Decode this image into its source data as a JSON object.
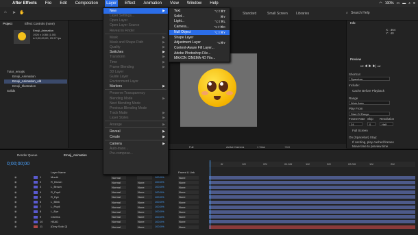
{
  "menubar": {
    "app": "After Effects",
    "items": [
      "File",
      "Edit",
      "Composition",
      "Layer",
      "Effect",
      "Animation",
      "View",
      "Window",
      "Help"
    ],
    "active": "Layer",
    "status": "100%"
  },
  "toolbar": {
    "workspaces": [
      "Standard",
      "Small Screen",
      "Libraries"
    ],
    "search_placeholder": "Search Help"
  },
  "project": {
    "tab_project": "Project",
    "tab_effects": "Effect Controls (none)",
    "comp_name": "Emoji_Animation",
    "info_lines": [
      "1920 x 1080 (1.00)",
      "Δ 0;00;00;00, 29.97 fps"
    ],
    "items": [
      "Tutor_emojis",
      "Emoji_Animation",
      "Emoji_Animation_old",
      "Emoji_Illustration",
      "Solids"
    ]
  },
  "layer_menu": {
    "items": [
      {
        "label": "New",
        "state": "hl",
        "arrow": true
      },
      {
        "label": "Layer Settings...",
        "state": "dis"
      },
      {
        "label": "Open Layer",
        "state": "dis"
      },
      {
        "label": "Open Layer Source",
        "state": "dis"
      },
      {
        "label": "Reveal in Finder",
        "state": "dis"
      },
      {
        "sep": true
      },
      {
        "label": "Mask",
        "state": "dis",
        "arrow": true
      },
      {
        "label": "Mask and Shape Path",
        "state": "dis",
        "arrow": true
      },
      {
        "label": "Quality",
        "state": "dis",
        "arrow": true
      },
      {
        "label": "Switches",
        "state": "",
        "arrow": true
      },
      {
        "label": "Transform",
        "state": "dis",
        "arrow": true
      },
      {
        "label": "Time",
        "state": "dis",
        "arrow": true
      },
      {
        "label": "Frame Blending",
        "state": "dis",
        "arrow": true
      },
      {
        "label": "3D Layer",
        "state": "dis"
      },
      {
        "label": "Guide Layer",
        "state": "dis"
      },
      {
        "label": "Environment Layer",
        "state": "dis"
      },
      {
        "label": "Markers",
        "state": "",
        "arrow": true
      },
      {
        "sep": true
      },
      {
        "label": "Preserve Transparency",
        "state": "dis"
      },
      {
        "label": "Blending Mode",
        "state": "dis",
        "arrow": true
      },
      {
        "label": "Next Blending Mode",
        "state": "dis"
      },
      {
        "label": "Previous Blending Mode",
        "state": "dis"
      },
      {
        "label": "Track Matte",
        "state": "dis",
        "arrow": true
      },
      {
        "label": "Layer Styles",
        "state": "dis",
        "arrow": true
      },
      {
        "sep": true
      },
      {
        "label": "Arrange",
        "state": "dis",
        "arrow": true
      },
      {
        "sep": true
      },
      {
        "label": "Reveal",
        "state": "",
        "arrow": true
      },
      {
        "label": "Create",
        "state": "",
        "arrow": true
      },
      {
        "sep": true
      },
      {
        "label": "Camera",
        "state": "",
        "arrow": true
      },
      {
        "label": "Auto-trace...",
        "state": "dis"
      },
      {
        "label": "Pre-compose...",
        "state": "dis"
      }
    ]
  },
  "new_menu": {
    "items": [
      {
        "label": "Text",
        "shortcut": "⌥⇧⌘T"
      },
      {
        "label": "Solid...",
        "shortcut": "⌘Y"
      },
      {
        "label": "Light...",
        "shortcut": "⌥⇧⌘L"
      },
      {
        "label": "Camera...",
        "shortcut": "⌥⇧⌘C"
      },
      {
        "label": "Null Object",
        "shortcut": "⌥⇧⌘Y",
        "hl": true
      },
      {
        "label": "Shape Layer",
        "shortcut": ""
      },
      {
        "label": "Adjustment Layer",
        "shortcut": "⌥⌘Y"
      },
      {
        "label": "Content-Aware Fill Layer...",
        "shortcut": ""
      },
      {
        "label": "Adobe Photoshop File...",
        "shortcut": ""
      },
      {
        "label": "MAXON CINEMA 4D File...",
        "shortcut": ""
      }
    ]
  },
  "viewer": {
    "zoom": "Full",
    "camera": "Active Camera",
    "views": "1 View",
    "exposure": "+0.0"
  },
  "info_panel": {
    "title": "Info",
    "x": "X : 364",
    "y": "Y : 40",
    "preview_title": "Preview",
    "shortcut_label": "Shortcut",
    "shortcut_value": "Spacebar",
    "include_label": "Include:",
    "cache": "Cache Before Playback",
    "range_label": "Range",
    "range_value": "Work Area",
    "play_from_label": "Play From",
    "play_from_value": "Start Of Range",
    "frame_rate_label": "Frame Rate",
    "skip_label": "Skip",
    "resolution_label": "Resolution",
    "frame_rate": "24",
    "skip": "0",
    "resolution": "Half",
    "full_screen": "Full Screen",
    "on_stop": "On (Spacebar) Stop:",
    "if_caching": "If caching, play cached frames",
    "move_time": "Move time to preview time"
  },
  "timeline": {
    "tabs": [
      "Render Queue",
      "Emoji_Animation"
    ],
    "timecode": "0;00;00;00",
    "col_layer": "Layer Name",
    "col_mode": "Mode",
    "col_parent": "Parent & Link",
    "ruler": [
      "0f",
      "10f",
      "20f",
      "01:00f",
      "10f",
      "20f",
      "02:00f",
      "10f",
      "20f"
    ],
    "layers": [
      {
        "num": "1",
        "name": "Mouth",
        "mode": "Normal",
        "trk": "",
        "pct": "100.0%",
        "parent": "None"
      },
      {
        "num": "2",
        "name": "R_Brown",
        "mode": "Normal",
        "trk": "None",
        "pct": "100.0%",
        "parent": "None"
      },
      {
        "num": "3",
        "name": "L_Brown",
        "mode": "Normal",
        "trk": "None",
        "pct": "100.0%",
        "parent": "None"
      },
      {
        "num": "4",
        "name": "R_Pupil",
        "mode": "Normal",
        "trk": "None",
        "pct": "100.0%",
        "parent": "None"
      },
      {
        "num": "5",
        "name": "R_Eye",
        "mode": "Normal",
        "trk": "None",
        "pct": "100.0%",
        "parent": "None"
      },
      {
        "num": "6",
        "name": "L_Blink",
        "mode": "Normal",
        "trk": "None",
        "pct": "100.0%",
        "parent": "None"
      },
      {
        "num": "7",
        "name": "L_Pupil",
        "mode": "Normal",
        "trk": "None",
        "pct": "100.0%",
        "parent": "None"
      },
      {
        "num": "8",
        "name": "L_Eye",
        "mode": "Normal",
        "trk": "None",
        "pct": "100.0%",
        "parent": "None"
      },
      {
        "num": "9",
        "name": "Cheeks",
        "mode": "Normal",
        "trk": "None",
        "pct": "100.0%",
        "parent": "None"
      },
      {
        "num": "10",
        "name": "HEAD",
        "mode": "Normal",
        "trk": "None",
        "pct": "100.0%",
        "parent": "None"
      },
      {
        "num": "11",
        "name": "[Grey Solid 2]",
        "mode": "Normal",
        "trk": "None",
        "pct": "100.0%",
        "parent": "None"
      }
    ]
  },
  "colors": {
    "accent": "#2b6de8",
    "timecode": "#4aa3ff",
    "layer_bar": "#4d5a8a",
    "solid_bar": "#8a3a3a"
  }
}
